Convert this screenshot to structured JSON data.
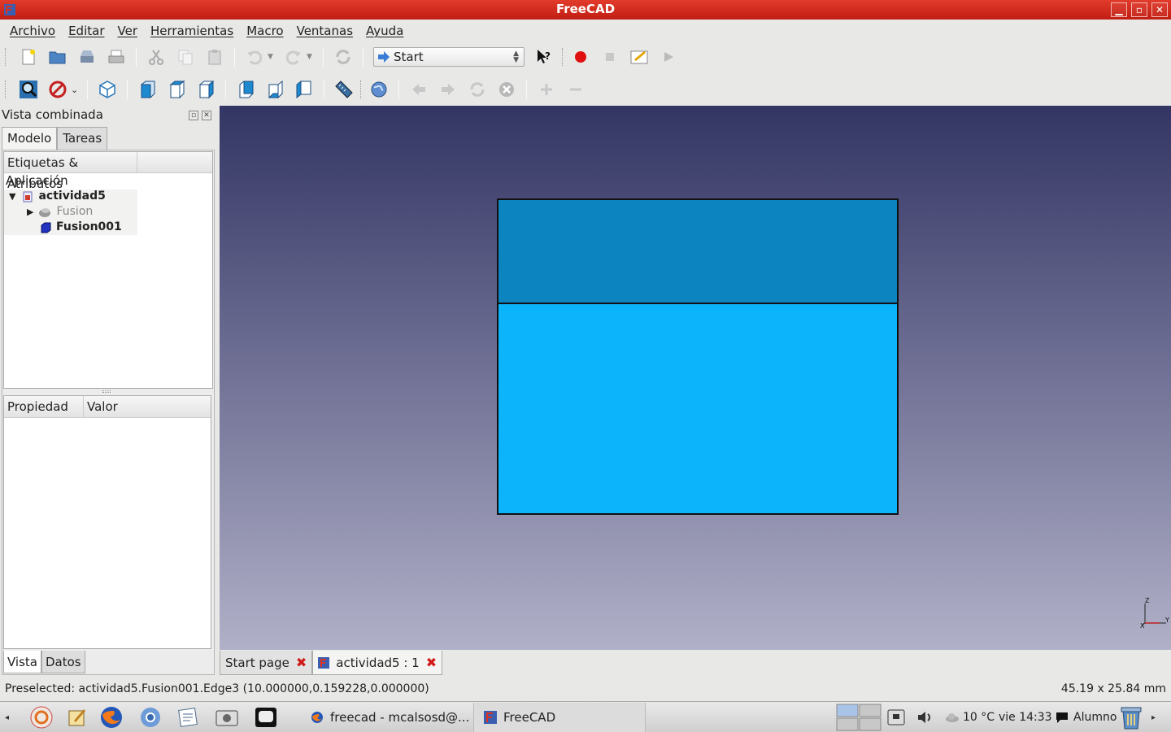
{
  "window": {
    "title": "FreeCAD"
  },
  "menu": [
    "Archivo",
    "Editar",
    "Ver",
    "Herramientas",
    "Macro",
    "Ventanas",
    "Ayuda"
  ],
  "toolbar": {
    "workbench": "Start"
  },
  "combo_view": {
    "title": "Vista combinada",
    "tabs": [
      "Modelo",
      "Tareas"
    ],
    "tree_header": "Etiquetas & Atributos",
    "tree": {
      "root": "Aplicación",
      "document": "actividad5",
      "items": [
        "Fusion",
        "Fusion001"
      ]
    },
    "props_header": {
      "property": "Propiedad",
      "value": "Valor"
    },
    "bottom_tabs": [
      "Vista",
      "Datos"
    ]
  },
  "view": {
    "top_face_color": "#0c84c0",
    "front_face_color": "#0cb5fb",
    "axis_labels": {
      "z": "Z",
      "x": "X",
      "y": "Y"
    }
  },
  "doc_tabs": [
    "Start page",
    "actividad5 : 1"
  ],
  "status": {
    "message": "Preselected: actividad5.Fusion001.Edge3 (10.000000,0.159228,0.000000)",
    "dimensions": "45.19 x 25.84 mm"
  },
  "taskbar": {
    "tasks": [
      "freecad - mcalsosd@...",
      "FreeCAD"
    ],
    "temperature": "10 °C",
    "clock": "vie 14:33",
    "user": "Alumno"
  }
}
